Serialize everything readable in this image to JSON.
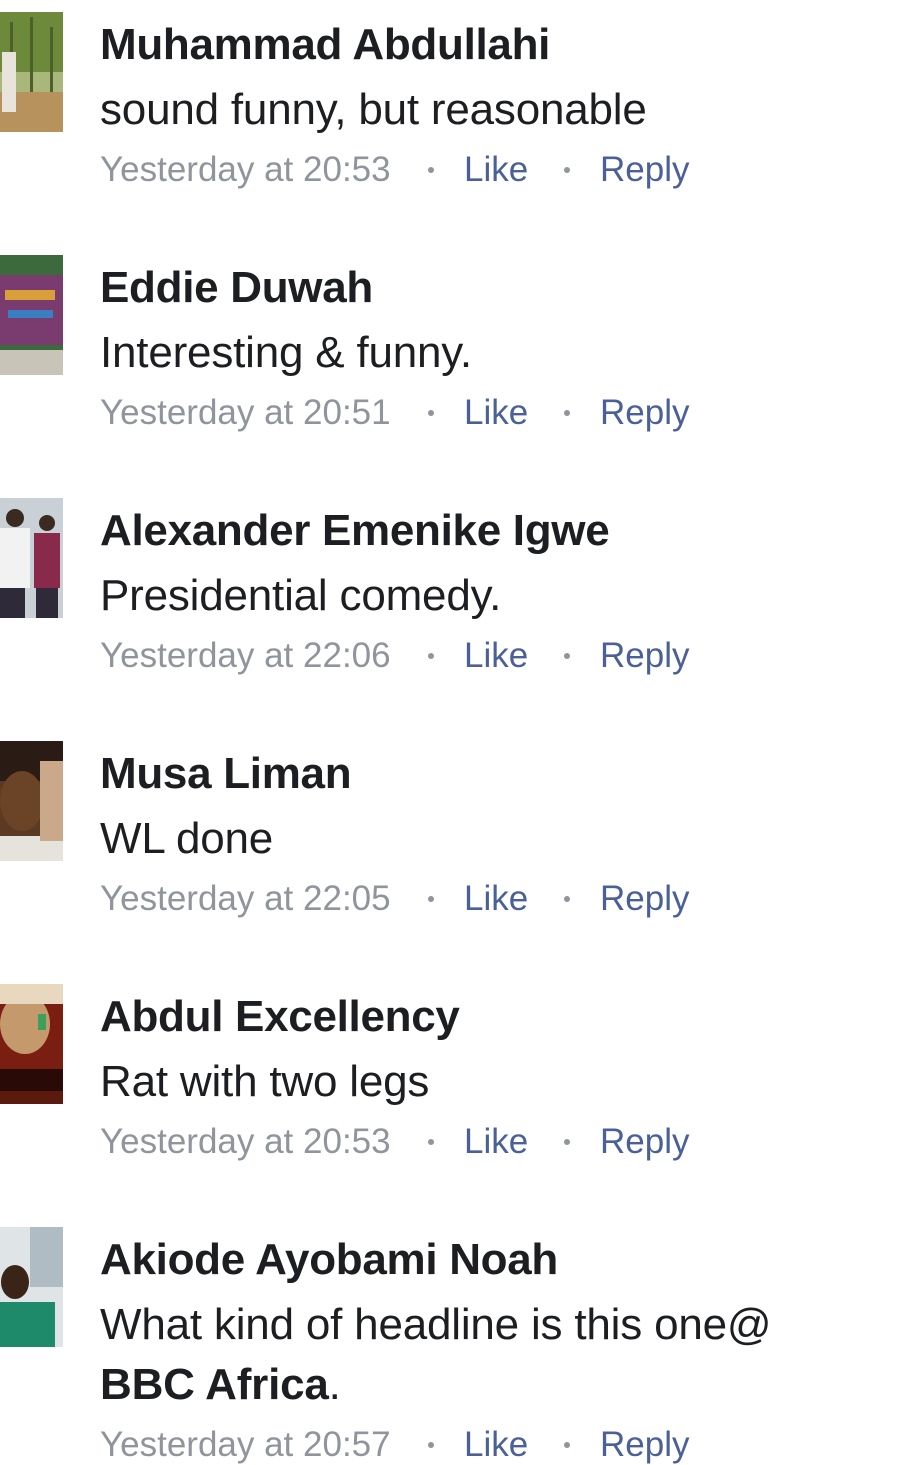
{
  "comments": [
    {
      "author": "Muhammad Abdullahi",
      "text": "sound funny, but reasonable",
      "time": "Yesterday at 20:53",
      "like": "Like",
      "reply": "Reply",
      "avatar_colors": [
        "#6d8a3a",
        "#a9b87a"
      ]
    },
    {
      "author": "Eddie Duwah",
      "text": "Interesting & funny.",
      "time": "Yesterday at 20:51",
      "like": "Like",
      "reply": "Reply",
      "avatar_colors": [
        "#7a3c6e",
        "#3d6a3c"
      ]
    },
    {
      "author": "Alexander Emenike Igwe",
      "text": "Presidential comedy.",
      "time": "Yesterday at 22:06",
      "like": "Like",
      "reply": "Reply",
      "avatar_colors": [
        "#c9d0d6",
        "#2e2a3a"
      ]
    },
    {
      "author": "Musa Liman",
      "text": "WL done",
      "time": "Yesterday at 22:05",
      "like": "Like",
      "reply": "Reply",
      "avatar_colors": [
        "#5a3a22",
        "#e6e2dc"
      ]
    },
    {
      "author": "Abdul Excellency",
      "text": "Rat with two legs",
      "time": "Yesterday at 20:53",
      "like": "Like",
      "reply": "Reply",
      "avatar_colors": [
        "#c49a6c",
        "#7a1e12"
      ]
    },
    {
      "author": "Akiode Ayobami Noah",
      "text": "What kind of headline is this one@",
      "mention": "BBC Africa",
      "mention_suffix": ".",
      "time": "Yesterday at 20:57",
      "like": "Like",
      "reply": "Reply",
      "avatar_colors": [
        "#dfe4e6",
        "#1f8a6a"
      ]
    }
  ]
}
